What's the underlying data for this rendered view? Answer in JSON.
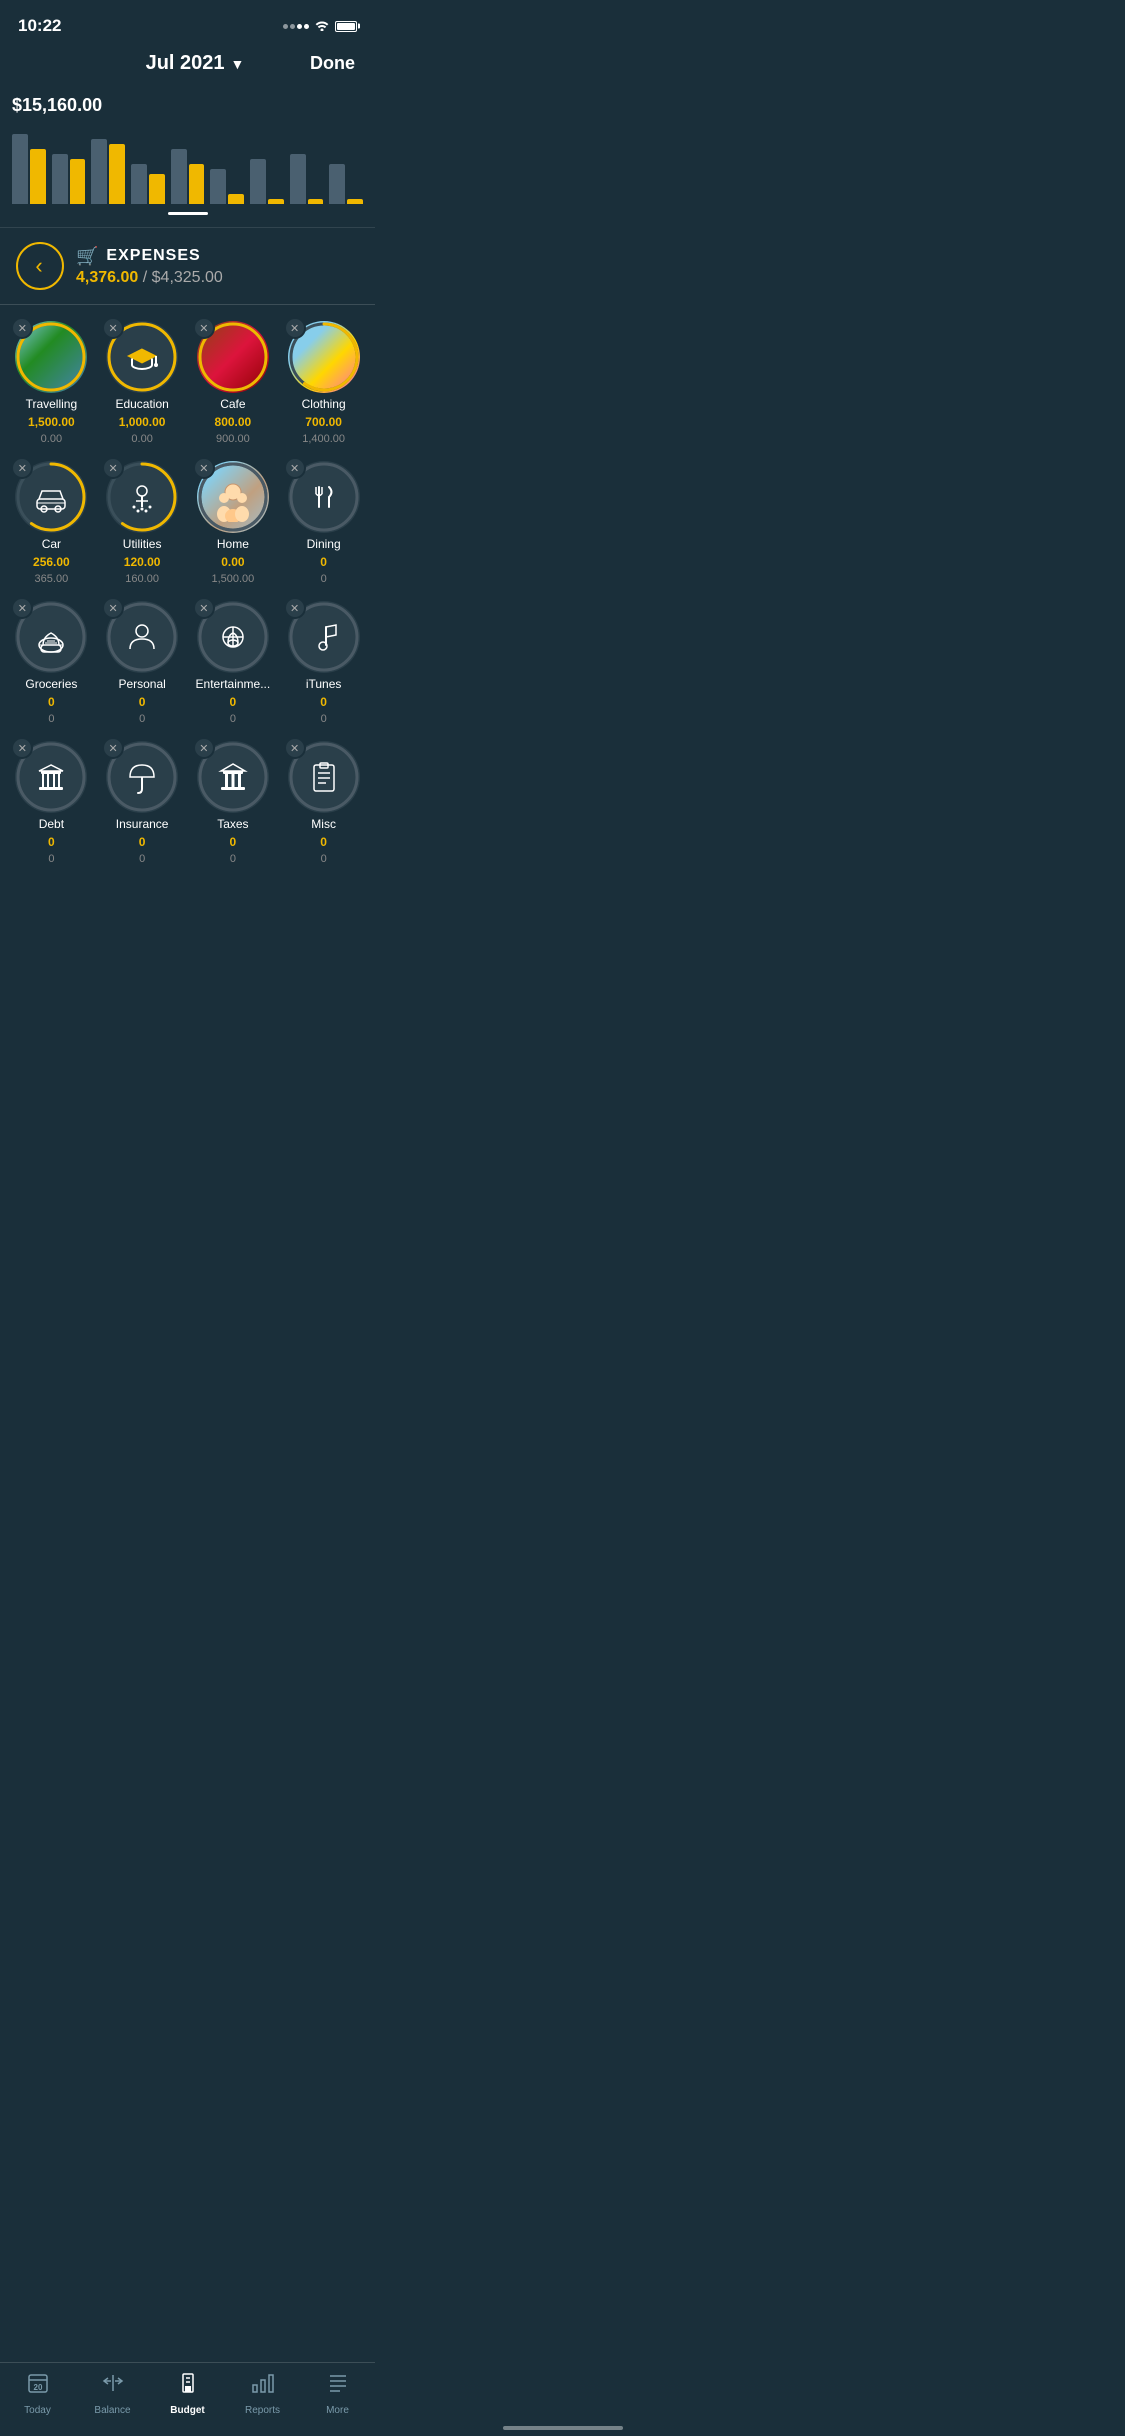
{
  "statusBar": {
    "time": "10:22"
  },
  "header": {
    "month": "Jul 2021",
    "chevron": "▼",
    "done": "Done"
  },
  "chart": {
    "amount": "$15,160.00",
    "bars": [
      {
        "budget": 70,
        "actual": 55
      },
      {
        "budget": 50,
        "actual": 45
      },
      {
        "budget": 65,
        "actual": 60
      },
      {
        "budget": 40,
        "actual": 30
      },
      {
        "budget": 55,
        "actual": 40
      },
      {
        "budget": 35,
        "actual": 10
      },
      {
        "budget": 45,
        "actual": 5
      },
      {
        "budget": 50,
        "actual": 5
      },
      {
        "budget": 40,
        "actual": 5
      }
    ]
  },
  "expenses": {
    "label": "EXPENSES",
    "actual": "4,376.00",
    "budget": "$4,325.00"
  },
  "categories": [
    {
      "name": "Travelling",
      "actual": "1,500.00",
      "budget": "0.00",
      "ring": "gold",
      "hasImage": true,
      "imageType": "travel"
    },
    {
      "name": "Education",
      "actual": "1,000.00",
      "budget": "0.00",
      "ring": "gold",
      "hasImage": false,
      "icon": "🎓"
    },
    {
      "name": "Cafe",
      "actual": "800.00",
      "budget": "900.00",
      "ring": "gold",
      "hasImage": true,
      "imageType": "cafe"
    },
    {
      "name": "Clothing",
      "actual": "700.00",
      "budget": "1,400.00",
      "ring": "partial",
      "hasImage": true,
      "imageType": "clothing"
    },
    {
      "name": "Car",
      "actual": "256.00",
      "budget": "365.00",
      "ring": "partial",
      "hasImage": false,
      "icon": "🚗"
    },
    {
      "name": "Utilities",
      "actual": "120.00",
      "budget": "160.00",
      "ring": "partial",
      "hasImage": false,
      "icon": "🚿"
    },
    {
      "name": "Home",
      "actual": "0.00",
      "budget": "1,500.00",
      "ring": "gray",
      "hasImage": true,
      "imageType": "home"
    },
    {
      "name": "Dining",
      "actual": "0",
      "budget": "0",
      "ring": "gray",
      "hasImage": false,
      "icon": "🍴"
    },
    {
      "name": "Groceries",
      "actual": "0",
      "budget": "0",
      "ring": "gray",
      "hasImage": false,
      "icon": "🧺"
    },
    {
      "name": "Personal",
      "actual": "0",
      "budget": "0",
      "ring": "gray",
      "hasImage": false,
      "icon": "👤"
    },
    {
      "name": "Entertainme...",
      "actual": "0",
      "budget": "0",
      "ring": "gray",
      "hasImage": false,
      "icon": "🎠"
    },
    {
      "name": "iTunes",
      "actual": "0",
      "budget": "0",
      "ring": "gray",
      "hasImage": false,
      "icon": "♪"
    },
    {
      "name": "Debt",
      "actual": "0",
      "budget": "0",
      "ring": "gray",
      "hasImage": false,
      "icon": "🏛"
    },
    {
      "name": "Insurance",
      "actual": "0",
      "budget": "0",
      "ring": "gray",
      "hasImage": false,
      "icon": "☂"
    },
    {
      "name": "Taxes",
      "actual": "0",
      "budget": "0",
      "ring": "gray",
      "hasImage": false,
      "icon": "🏦"
    },
    {
      "name": "Misc",
      "actual": "0",
      "budget": "0",
      "ring": "gray",
      "hasImage": false,
      "icon": "📋"
    }
  ],
  "bottomNav": {
    "items": [
      {
        "label": "Today",
        "icon": "today",
        "active": false
      },
      {
        "label": "Balance",
        "icon": "balance",
        "active": false
      },
      {
        "label": "Budget",
        "icon": "budget",
        "active": true
      },
      {
        "label": "Reports",
        "icon": "reports",
        "active": false
      },
      {
        "label": "More",
        "icon": "more",
        "active": false
      }
    ]
  }
}
